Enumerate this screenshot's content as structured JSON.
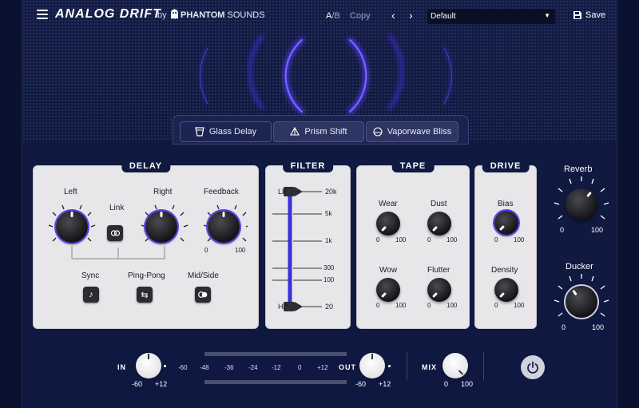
{
  "header": {
    "title": "ANALOG DRIFT",
    "by": "by",
    "brand_bold": "PHANTOM",
    "brand_rest": " SOUNDS",
    "ab_a": "A",
    "ab_sep": "/",
    "ab_b": "B",
    "copy": "Copy",
    "prev": "‹",
    "next": "›",
    "preset": "Default",
    "save": "Save"
  },
  "tabs": [
    {
      "label": "Glass Delay",
      "icon": "cup-icon",
      "active": true
    },
    {
      "label": "Prism Shift",
      "icon": "prism-icon",
      "active": false
    },
    {
      "label": "Vaporwave Bliss",
      "icon": "sun-icon",
      "active": false
    }
  ],
  "delay": {
    "title": "DELAY",
    "left": "Left",
    "right": "Right",
    "link": "Link",
    "feedback": "Feedback",
    "fb_min": "0",
    "fb_max": "100",
    "sync": "Sync",
    "pingpong": "Ping-Pong",
    "midside": "Mid/Side"
  },
  "filter": {
    "title": "FILTER",
    "lp": "LP",
    "hp": "HP",
    "ticks": [
      "20k",
      "5k",
      "1k",
      "300",
      "100",
      "20"
    ]
  },
  "tape": {
    "title": "TAPE",
    "wear": "Wear",
    "dust": "Dust",
    "wow": "Wow",
    "flutter": "Flutter",
    "min": "0",
    "max": "100"
  },
  "drive": {
    "title": "DRIVE",
    "bias": "Bias",
    "density": "Density",
    "min": "0",
    "max": "100"
  },
  "reverb": {
    "label": "Reverb",
    "min": "0",
    "max": "100"
  },
  "ducker": {
    "label": "Ducker",
    "min": "0",
    "max": "100"
  },
  "io": {
    "in_label": "IN",
    "in_min": "-60",
    "in_max": "+12",
    "out_label": "OUT",
    "out_min": "-60",
    "out_max": "+12",
    "mix_label": "MIX",
    "mix_min": "0",
    "mix_max": "100",
    "meter_scale": [
      "-60",
      "-48",
      "-36",
      "-24",
      "-12",
      "0",
      "+12"
    ]
  },
  "colors": {
    "accent": "#5a3ff0",
    "background": "#101a40",
    "panel": "#e7e7ea"
  }
}
